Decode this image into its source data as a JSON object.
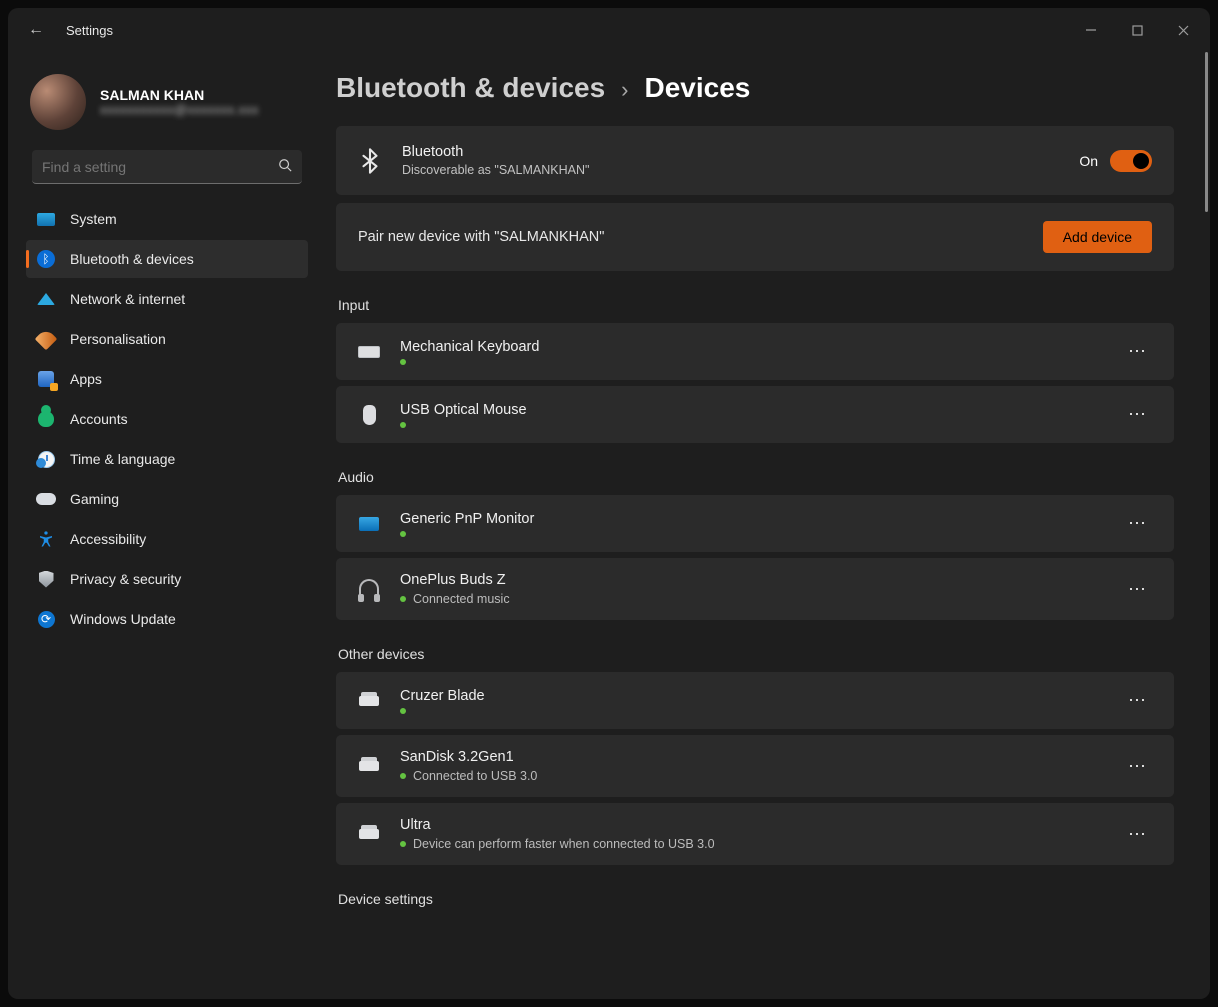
{
  "app_title": "Settings",
  "profile": {
    "name": "SALMAN KHAN",
    "email_masked": "xxxxxxxxxxx@xxxxxxx.xxx"
  },
  "search": {
    "placeholder": "Find a setting"
  },
  "nav": {
    "system": "System",
    "bluetooth": "Bluetooth & devices",
    "network": "Network & internet",
    "personalisation": "Personalisation",
    "apps": "Apps",
    "accounts": "Accounts",
    "time": "Time & language",
    "gaming": "Gaming",
    "accessibility": "Accessibility",
    "privacy": "Privacy & security",
    "update": "Windows Update"
  },
  "breadcrumb": {
    "parent": "Bluetooth & devices",
    "current": "Devices"
  },
  "bluetooth_card": {
    "title": "Bluetooth",
    "sub": "Discoverable as \"SALMANKHAN\"",
    "state_label": "On"
  },
  "pair": {
    "text": "Pair new device with \"SALMANKHAN\"",
    "button": "Add device"
  },
  "sections": {
    "input": "Input",
    "audio": "Audio",
    "other": "Other devices",
    "settings": "Device settings"
  },
  "devices": {
    "input": [
      {
        "name": "Mechanical Keyboard",
        "status": ""
      },
      {
        "name": "USB Optical Mouse",
        "status": ""
      }
    ],
    "audio": [
      {
        "name": "Generic PnP Monitor",
        "status": ""
      },
      {
        "name": "OnePlus Buds Z",
        "status": "Connected music"
      }
    ],
    "other": [
      {
        "name": "Cruzer Blade",
        "status": ""
      },
      {
        "name": "SanDisk 3.2Gen1",
        "status": "Connected to USB 3.0"
      },
      {
        "name": "Ultra",
        "status": "Device can perform faster when connected to USB 3.0"
      }
    ]
  }
}
